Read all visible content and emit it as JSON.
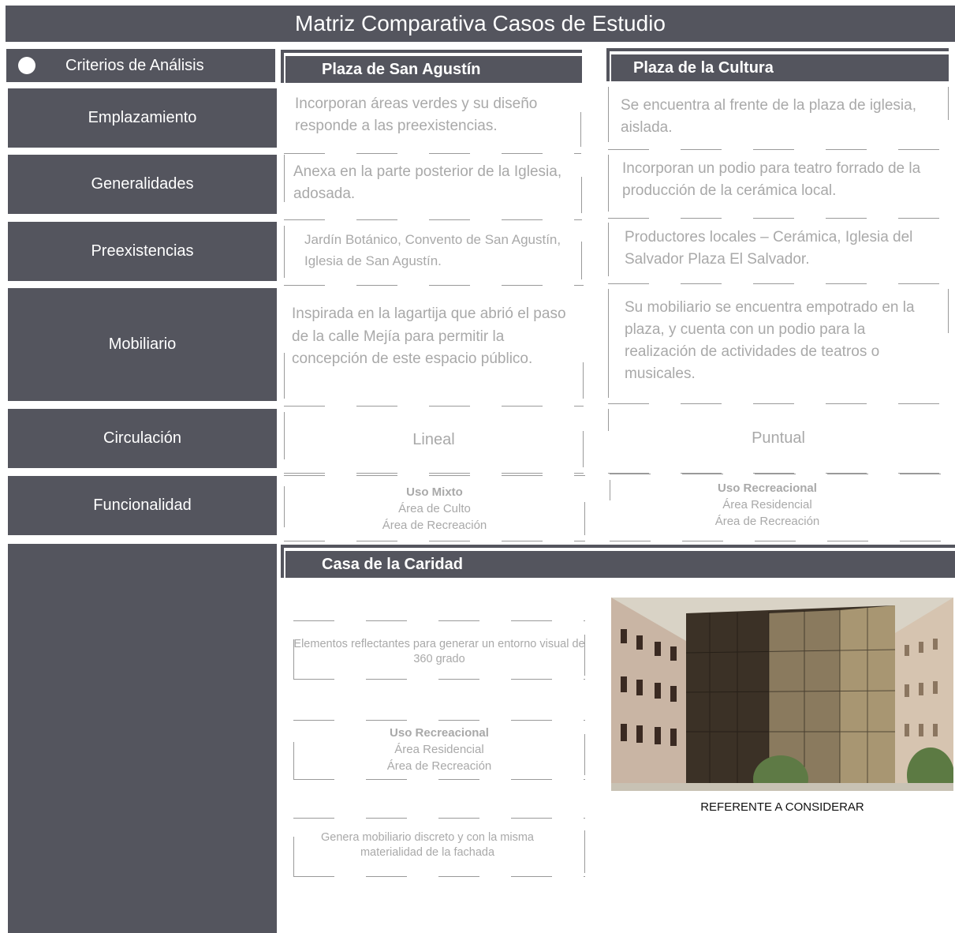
{
  "title": "Matriz Comparativa Casos de Estudio",
  "criteria_header": "Criterios de Análisis",
  "rows": [
    "Emplazamiento",
    "Generalidades",
    "Preexistencias",
    "Mobiliario",
    "Circulación",
    "Funcionalidad"
  ],
  "columns": {
    "san_agustin": {
      "title": "Plaza de San Agustín",
      "emplazamiento": "Incorporan áreas verdes y su diseño responde a las preexistencias.",
      "generalidades": "Anexa en la parte posterior de la Iglesia, adosada.",
      "preexistencias": "Jardín Botánico, Convento de San Agustín, Iglesia de San Agustín.",
      "mobiliario": "Inspirada en la lagartija que abrió el paso de la calle Mejía para permitir la concepción de este espacio público.",
      "circulacion": "Lineal",
      "funcionalidad": {
        "heading": "Uso Mixto",
        "lines": [
          "Área de Culto",
          "Área de Recreación"
        ]
      }
    },
    "cultura": {
      "title": "Plaza de la Cultura",
      "emplazamiento": "Se encuentra al frente de la plaza de iglesia, aislada.",
      "generalidades": "Incorporan un podio para teatro forrado de la producción de la cerámica local.",
      "preexistencias": "Productores locales – Cerámica, Iglesia del Salvador Plaza El Salvador.",
      "mobiliario": "Su mobiliario se encuentra empotrado en la plaza, y cuenta con un podio para la realización de actividades de teatros o musicales.",
      "circulacion": "Puntual",
      "funcionalidad": {
        "heading": "Uso Recreacional",
        "lines": [
          "Área Residencial",
          "Área de Recreación"
        ]
      }
    }
  },
  "caridad": {
    "title": "Casa de la Caridad",
    "item1": "Elementos reflectantes para generar un entorno visual de 360 grado",
    "item2": {
      "heading": "Uso Recreacional",
      "lines": [
        "Área Residencial",
        "Área de Recreación"
      ]
    },
    "item3": "Genera mobiliario discreto y con la misma materialidad de la fachada",
    "caption": "REFERENTE A CONSIDERAR"
  },
  "colors": {
    "panel": "#54555e",
    "cell_text": "#a9a9a9",
    "dash": "#9a9a9a"
  }
}
